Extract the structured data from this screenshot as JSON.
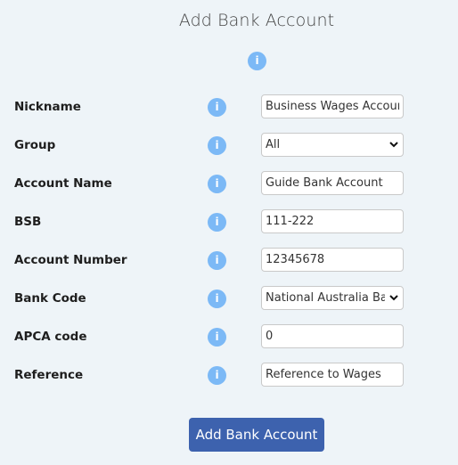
{
  "page": {
    "title": "Add Bank Account",
    "info_icon_glyph": "i"
  },
  "form": {
    "fields": [
      {
        "label": "Nickname",
        "type": "text",
        "value": "Business Wages Account",
        "icon": "info-icon"
      },
      {
        "label": "Group",
        "type": "select",
        "value": "All",
        "icon": "info-icon"
      },
      {
        "label": "Account Name",
        "type": "text",
        "value": "Guide Bank Account",
        "icon": "info-icon"
      },
      {
        "label": "BSB",
        "type": "text",
        "value": "111-222",
        "icon": "info-icon"
      },
      {
        "label": "Account Number",
        "type": "text",
        "value": "12345678",
        "icon": "info-icon"
      },
      {
        "label": "Bank Code",
        "type": "select",
        "value": "National Australia Bank",
        "icon": "info-icon"
      },
      {
        "label": "APCA code",
        "type": "text",
        "value": "0",
        "icon": "info-icon"
      },
      {
        "label": "Reference",
        "type": "text",
        "value": "Reference to Wages",
        "icon": "info-icon"
      }
    ],
    "submit_label": "Add Bank Account"
  },
  "colors": {
    "background": "#eef4f8",
    "info_icon": "#7cb9f6",
    "primary_button": "#3d62ae"
  }
}
